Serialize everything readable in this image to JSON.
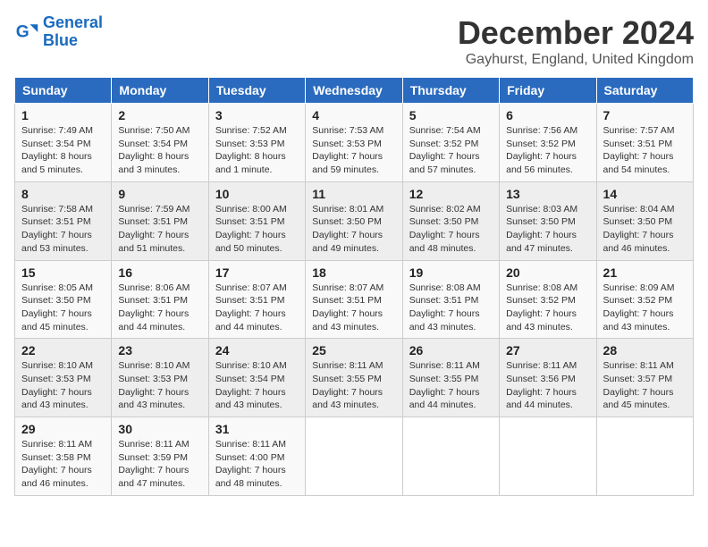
{
  "logo": {
    "line1": "General",
    "line2": "Blue"
  },
  "title": "December 2024",
  "subtitle": "Gayhurst, England, United Kingdom",
  "days_of_week": [
    "Sunday",
    "Monday",
    "Tuesday",
    "Wednesday",
    "Thursday",
    "Friday",
    "Saturday"
  ],
  "weeks": [
    [
      {
        "day": "1",
        "sunrise": "7:49 AM",
        "sunset": "3:54 PM",
        "daylight": "8 hours and 5 minutes."
      },
      {
        "day": "2",
        "sunrise": "7:50 AM",
        "sunset": "3:54 PM",
        "daylight": "8 hours and 3 minutes."
      },
      {
        "day": "3",
        "sunrise": "7:52 AM",
        "sunset": "3:53 PM",
        "daylight": "8 hours and 1 minute."
      },
      {
        "day": "4",
        "sunrise": "7:53 AM",
        "sunset": "3:53 PM",
        "daylight": "7 hours and 59 minutes."
      },
      {
        "day": "5",
        "sunrise": "7:54 AM",
        "sunset": "3:52 PM",
        "daylight": "7 hours and 57 minutes."
      },
      {
        "day": "6",
        "sunrise": "7:56 AM",
        "sunset": "3:52 PM",
        "daylight": "7 hours and 56 minutes."
      },
      {
        "day": "7",
        "sunrise": "7:57 AM",
        "sunset": "3:51 PM",
        "daylight": "7 hours and 54 minutes."
      }
    ],
    [
      {
        "day": "8",
        "sunrise": "7:58 AM",
        "sunset": "3:51 PM",
        "daylight": "7 hours and 53 minutes."
      },
      {
        "day": "9",
        "sunrise": "7:59 AM",
        "sunset": "3:51 PM",
        "daylight": "7 hours and 51 minutes."
      },
      {
        "day": "10",
        "sunrise": "8:00 AM",
        "sunset": "3:51 PM",
        "daylight": "7 hours and 50 minutes."
      },
      {
        "day": "11",
        "sunrise": "8:01 AM",
        "sunset": "3:50 PM",
        "daylight": "7 hours and 49 minutes."
      },
      {
        "day": "12",
        "sunrise": "8:02 AM",
        "sunset": "3:50 PM",
        "daylight": "7 hours and 48 minutes."
      },
      {
        "day": "13",
        "sunrise": "8:03 AM",
        "sunset": "3:50 PM",
        "daylight": "7 hours and 47 minutes."
      },
      {
        "day": "14",
        "sunrise": "8:04 AM",
        "sunset": "3:50 PM",
        "daylight": "7 hours and 46 minutes."
      }
    ],
    [
      {
        "day": "15",
        "sunrise": "8:05 AM",
        "sunset": "3:50 PM",
        "daylight": "7 hours and 45 minutes."
      },
      {
        "day": "16",
        "sunrise": "8:06 AM",
        "sunset": "3:51 PM",
        "daylight": "7 hours and 44 minutes."
      },
      {
        "day": "17",
        "sunrise": "8:07 AM",
        "sunset": "3:51 PM",
        "daylight": "7 hours and 44 minutes."
      },
      {
        "day": "18",
        "sunrise": "8:07 AM",
        "sunset": "3:51 PM",
        "daylight": "7 hours and 43 minutes."
      },
      {
        "day": "19",
        "sunrise": "8:08 AM",
        "sunset": "3:51 PM",
        "daylight": "7 hours and 43 minutes."
      },
      {
        "day": "20",
        "sunrise": "8:08 AM",
        "sunset": "3:52 PM",
        "daylight": "7 hours and 43 minutes."
      },
      {
        "day": "21",
        "sunrise": "8:09 AM",
        "sunset": "3:52 PM",
        "daylight": "7 hours and 43 minutes."
      }
    ],
    [
      {
        "day": "22",
        "sunrise": "8:10 AM",
        "sunset": "3:53 PM",
        "daylight": "7 hours and 43 minutes."
      },
      {
        "day": "23",
        "sunrise": "8:10 AM",
        "sunset": "3:53 PM",
        "daylight": "7 hours and 43 minutes."
      },
      {
        "day": "24",
        "sunrise": "8:10 AM",
        "sunset": "3:54 PM",
        "daylight": "7 hours and 43 minutes."
      },
      {
        "day": "25",
        "sunrise": "8:11 AM",
        "sunset": "3:55 PM",
        "daylight": "7 hours and 43 minutes."
      },
      {
        "day": "26",
        "sunrise": "8:11 AM",
        "sunset": "3:55 PM",
        "daylight": "7 hours and 44 minutes."
      },
      {
        "day": "27",
        "sunrise": "8:11 AM",
        "sunset": "3:56 PM",
        "daylight": "7 hours and 44 minutes."
      },
      {
        "day": "28",
        "sunrise": "8:11 AM",
        "sunset": "3:57 PM",
        "daylight": "7 hours and 45 minutes."
      }
    ],
    [
      {
        "day": "29",
        "sunrise": "8:11 AM",
        "sunset": "3:58 PM",
        "daylight": "7 hours and 46 minutes."
      },
      {
        "day": "30",
        "sunrise": "8:11 AM",
        "sunset": "3:59 PM",
        "daylight": "7 hours and 47 minutes."
      },
      {
        "day": "31",
        "sunrise": "8:11 AM",
        "sunset": "4:00 PM",
        "daylight": "7 hours and 48 minutes."
      },
      null,
      null,
      null,
      null
    ]
  ]
}
